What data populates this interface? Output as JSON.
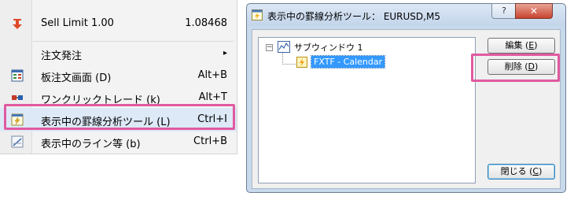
{
  "menu": {
    "items": [
      {
        "label": "Sell Limit 1.00",
        "shortcut": "1.08468",
        "icon": "sell-limit-arrow-icon"
      },
      {
        "label": "注文発注",
        "shortcut": "▸",
        "icon": ""
      },
      {
        "label": "板注文画面 (D)",
        "shortcut": "Alt+B",
        "icon": "order-board-icon"
      },
      {
        "label": "ワンクリックトレード (k)",
        "shortcut": "Alt+T",
        "icon": "one-click-trade-icon"
      },
      {
        "label": "表示中の罫線分析ツール (L)",
        "shortcut": "Ctrl+I",
        "icon": "analysis-tools-list-icon"
      },
      {
        "label": "表示中のライン等 (b)",
        "shortcut": "Ctrl+B",
        "icon": "lines-list-icon"
      }
    ]
  },
  "dialog": {
    "title": "表示中の罫線分析ツール： EURUSD,M5",
    "help_label": "?",
    "close_label": "✕",
    "tree": {
      "expander": "−",
      "root_label": "サブウィンドウ 1",
      "child_label": "FXTF - Calendar"
    },
    "buttons": {
      "edit": "編集",
      "edit_key": "E",
      "delete": "削除",
      "delete_key": "D",
      "close": "閉じる",
      "close_key": "C"
    }
  },
  "colors": {
    "highlight_frame": "#e05aa0",
    "selection": "#3399ff",
    "sell_arrow": "#e04a2a"
  }
}
